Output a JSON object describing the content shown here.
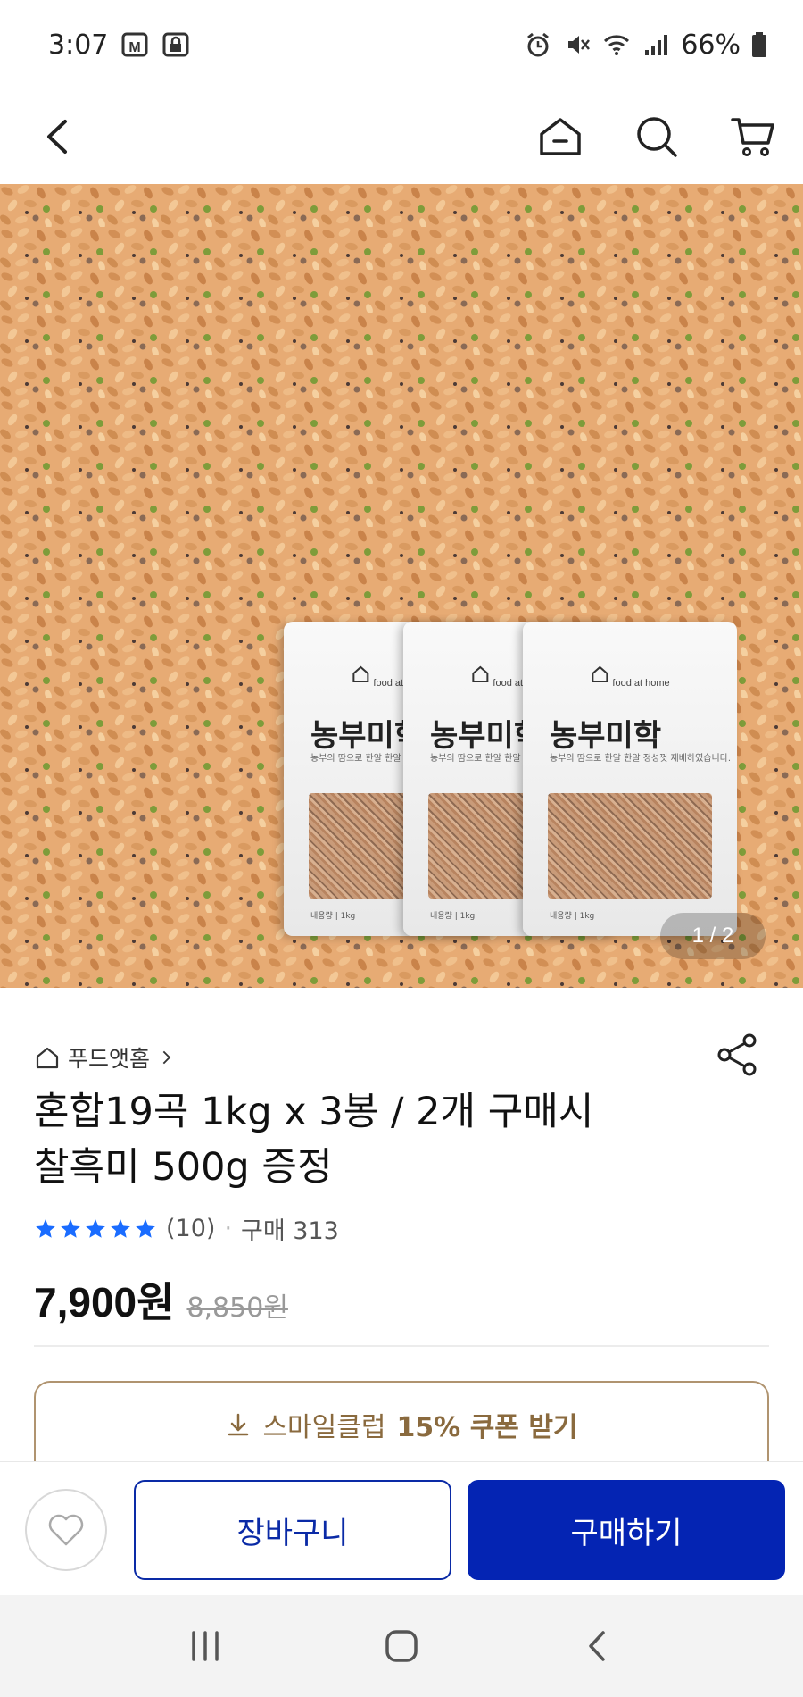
{
  "status_bar": {
    "time": "3:07",
    "battery": "66%",
    "icons": [
      "m-badge-icon",
      "lock-badge-icon",
      "alarm-icon",
      "mute-icon",
      "wifi-icon",
      "signal-icon",
      "battery-icon"
    ]
  },
  "top_nav": {
    "icons": [
      "back-icon",
      "home-icon",
      "search-icon",
      "cart-icon"
    ]
  },
  "hero": {
    "pack_brand": "food at home",
    "pack_title": "농부미학",
    "pack_subtitle": "농부의 땀으로 한알 한알 정성껏 재배하였습니다.",
    "pack_foot": "내용량 | 1kg",
    "pager": "1 / 2"
  },
  "product": {
    "store_name": "푸드앳홈",
    "title_line1": "혼합19곡 1kg x 3봉 / 2개 구매시",
    "title_line2": "찰흑미 500g 증정",
    "rating_stars": 5,
    "review_count": "(10)",
    "purchase_label": "구매 313",
    "price": "7,900원",
    "original_price": "8,850원"
  },
  "coupon": {
    "prefix": "스마일클럽",
    "strong": "15% 쿠폰 받기"
  },
  "action_bar": {
    "cart_label": "장바구니",
    "buy_label": "구매하기"
  },
  "colors": {
    "primary": "#0424b3",
    "coupon_border": "#b09470",
    "coupon_text": "#8a6a3e",
    "star": "#1a6cff"
  }
}
